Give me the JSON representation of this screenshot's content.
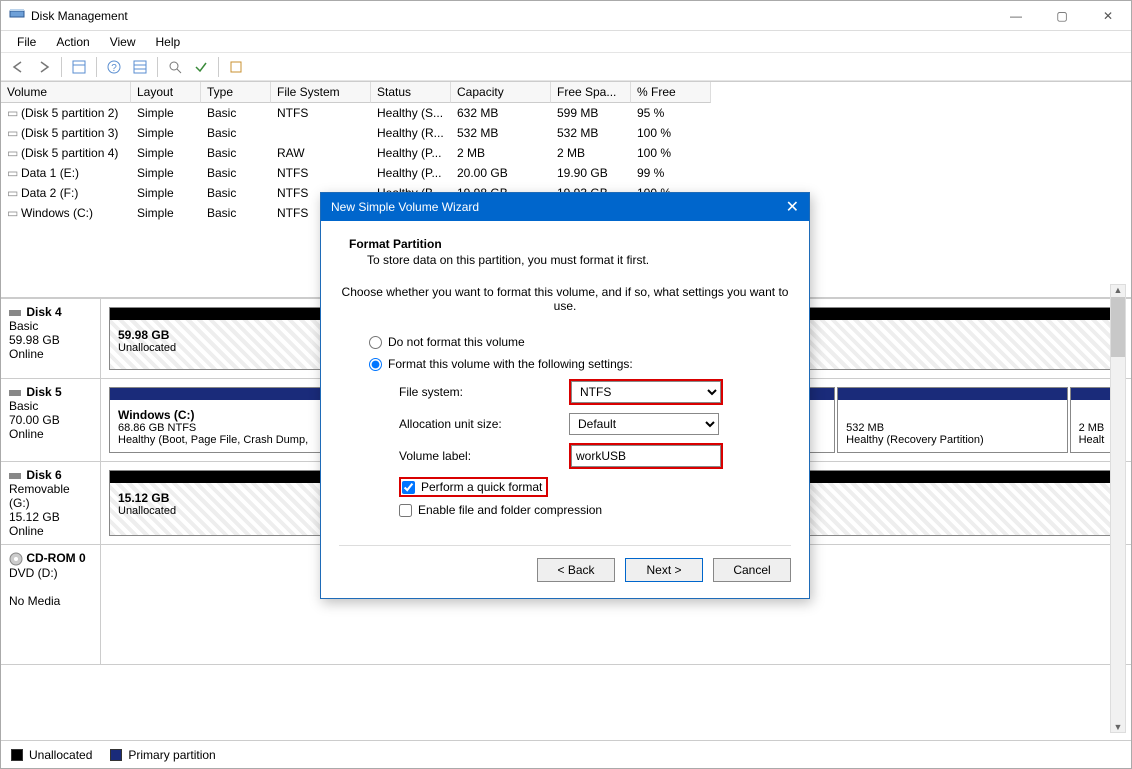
{
  "window": {
    "title": "Disk Management"
  },
  "menubar": [
    "File",
    "Action",
    "View",
    "Help"
  ],
  "table": {
    "headers": {
      "volume": "Volume",
      "layout": "Layout",
      "type": "Type",
      "fs": "File System",
      "status": "Status",
      "capacity": "Capacity",
      "free": "Free Spa...",
      "pfree": "% Free"
    },
    "rows": [
      {
        "volume": "(Disk 5 partition 2)",
        "layout": "Simple",
        "type": "Basic",
        "fs": "NTFS",
        "status": "Healthy (S...",
        "capacity": "632 MB",
        "free": "599 MB",
        "pfree": "95 %"
      },
      {
        "volume": "(Disk 5 partition 3)",
        "layout": "Simple",
        "type": "Basic",
        "fs": "",
        "status": "Healthy (R...",
        "capacity": "532 MB",
        "free": "532 MB",
        "pfree": "100 %"
      },
      {
        "volume": "(Disk 5 partition 4)",
        "layout": "Simple",
        "type": "Basic",
        "fs": "RAW",
        "status": "Healthy (P...",
        "capacity": "2 MB",
        "free": "2 MB",
        "pfree": "100 %"
      },
      {
        "volume": "Data 1 (E:)",
        "layout": "Simple",
        "type": "Basic",
        "fs": "NTFS",
        "status": "Healthy (P...",
        "capacity": "20.00 GB",
        "free": "19.90 GB",
        "pfree": "99 %"
      },
      {
        "volume": "Data 2 (F:)",
        "layout": "Simple",
        "type": "Basic",
        "fs": "NTFS",
        "status": "Healthy (B...",
        "capacity": "19.98 GB",
        "free": "19.93 GB",
        "pfree": "100 %"
      },
      {
        "volume": "Windows (C:)",
        "layout": "Simple",
        "type": "Basic",
        "fs": "NTFS",
        "status": "",
        "capacity": "",
        "free": "",
        "pfree": ""
      }
    ]
  },
  "disks": {
    "d4": {
      "name": "Disk 4",
      "type": "Basic",
      "size": "59.98 GB",
      "status": "Online",
      "part": {
        "label": "59.98 GB",
        "sub": "Unallocated"
      }
    },
    "d5": {
      "name": "Disk 5",
      "type": "Basic",
      "size": "70.00 GB",
      "status": "Online",
      "p1": {
        "label": "Windows  (C:)",
        "sub1": "68.86 GB NTFS",
        "sub2": "Healthy (Boot, Page File, Crash Dump,"
      },
      "p2": {
        "label": "",
        "sub1": "532 MB",
        "sub2": "Healthy (Recovery Partition)"
      },
      "p3": {
        "label": "",
        "sub1": "2 MB",
        "sub2": "Healt"
      }
    },
    "d6": {
      "name": "Disk 6",
      "type": "Removable (G:)",
      "size": "15.12 GB",
      "status": "Online",
      "part": {
        "label": "15.12 GB",
        "sub": "Unallocated"
      }
    },
    "cd": {
      "name": "CD-ROM 0",
      "type": "DVD (D:)",
      "size": "",
      "status": "No Media"
    }
  },
  "legend": {
    "unalloc": "Unallocated",
    "primary": "Primary partition"
  },
  "dialog": {
    "title": "New Simple Volume Wizard",
    "heading": "Format Partition",
    "subheading": "To store data on this partition, you must format it first.",
    "intro": "Choose whether you want to format this volume, and if so, what settings you want to use.",
    "radio1": "Do not format this volume",
    "radio2": "Format this volume with the following settings:",
    "lbl_fs": "File system:",
    "lbl_alloc": "Allocation unit size:",
    "lbl_label": "Volume label:",
    "val_fs": "NTFS",
    "val_alloc": "Default",
    "val_label": "workUSB",
    "chk_quick": "Perform a quick format",
    "chk_compress": "Enable file and folder compression",
    "btn_back": "< Back",
    "btn_next": "Next >",
    "btn_cancel": "Cancel"
  }
}
